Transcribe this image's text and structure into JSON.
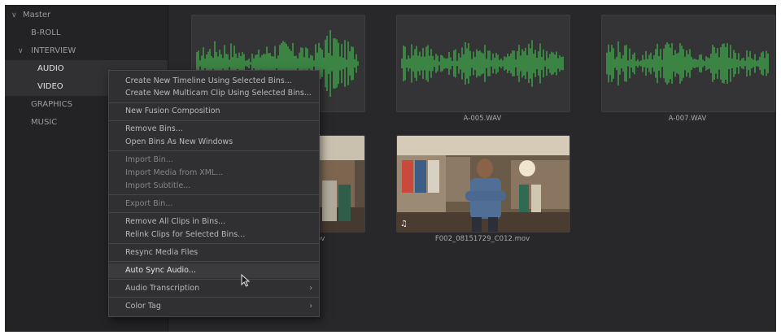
{
  "sidebar": {
    "master_label": "Master",
    "items": [
      {
        "label": "B-ROLL"
      },
      {
        "label": "INTERVIEW"
      },
      {
        "label": "AUDIO"
      },
      {
        "label": "VIDEO"
      },
      {
        "label": "GRAPHICS"
      },
      {
        "label": "MUSIC"
      }
    ]
  },
  "clips": [
    {
      "name": "",
      "type": "audio",
      "icon": "waveform"
    },
    {
      "name": "A-005.WAV",
      "type": "audio",
      "icon": "waveform"
    },
    {
      "name": "A-007.WAV",
      "type": "audio",
      "icon": "waveform"
    },
    {
      "name": "...mov",
      "type": "video",
      "icon": "video-thumbnail"
    },
    {
      "name": "F002_08151729_C012.mov",
      "type": "video",
      "icon": "video-thumbnail",
      "badge": "music-note-icon"
    }
  ],
  "clip_partial_label": "ov",
  "context_menu": {
    "items": [
      {
        "label": "Create New Timeline Using Selected Bins..."
      },
      {
        "label": "Create New Multicam Clip Using Selected Bins..."
      },
      {
        "label": "New Fusion Composition"
      },
      {
        "label": "Remove Bins..."
      },
      {
        "label": "Open Bins As New Windows"
      },
      {
        "label": "Import Bin..."
      },
      {
        "label": "Import Media from XML..."
      },
      {
        "label": "Import Subtitle..."
      },
      {
        "label": "Export Bin..."
      },
      {
        "label": "Remove All Clips in Bins..."
      },
      {
        "label": "Relink Clips for Selected Bins..."
      },
      {
        "label": "Resync Media Files"
      },
      {
        "label": "Auto Sync Audio...",
        "highlighted": true
      },
      {
        "label": "Audio Transcription",
        "submenu": true
      },
      {
        "label": "Color Tag",
        "submenu": true
      }
    ]
  },
  "colors": {
    "waveform": "#3fa64a",
    "panel_bg": "#28282a",
    "menu_bg": "#303032"
  }
}
